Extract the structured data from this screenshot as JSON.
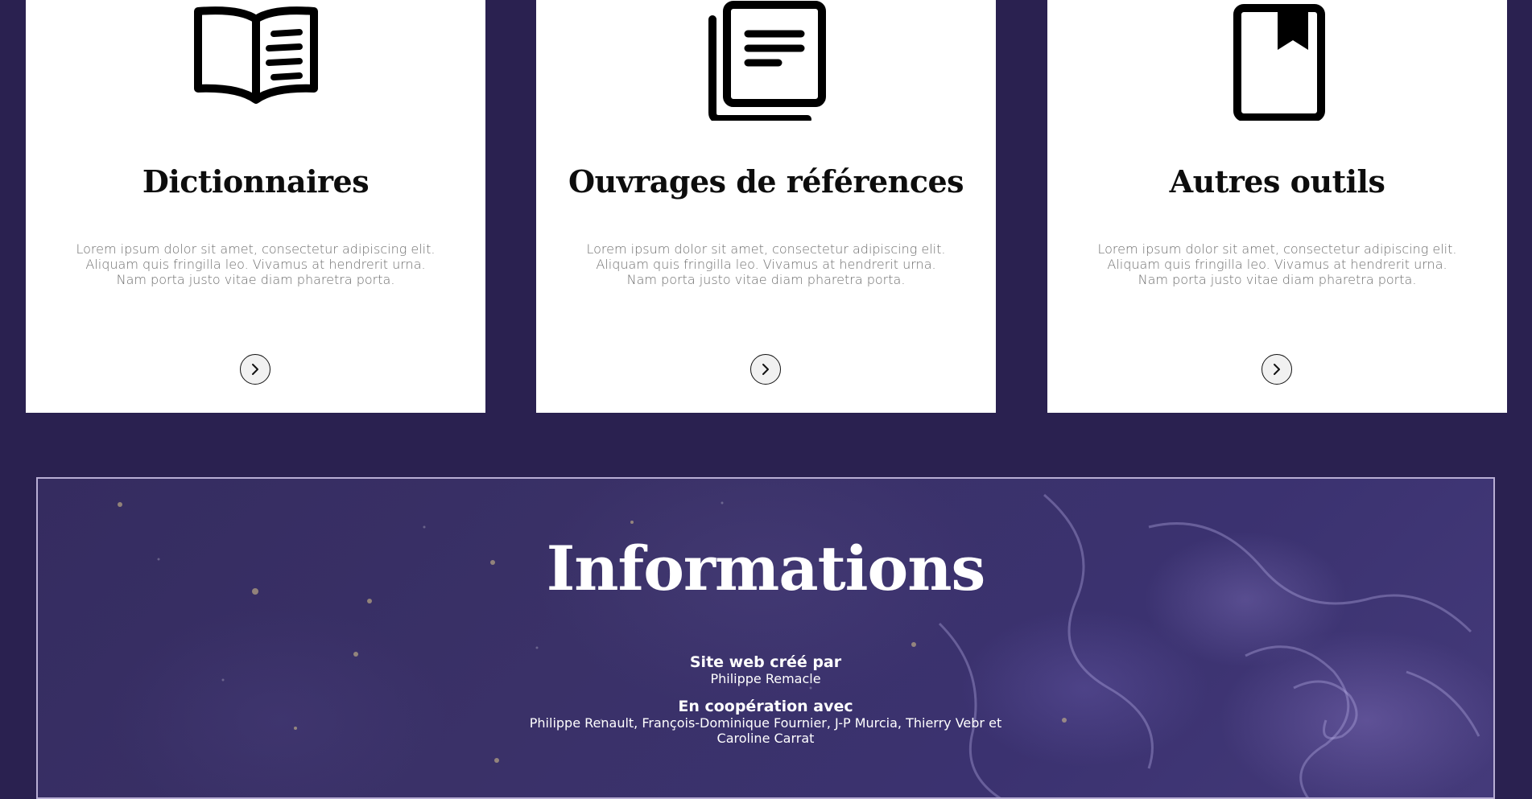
{
  "cards": [
    {
      "icon": "open-book-icon",
      "title": "Dictionnaires",
      "text": "Lorem ipsum dolor sit amet, consectetur adipiscing elit. Aliquam quis fringilla leo. Vivamus at hendrerit urna. Nam porta justo vitae diam pharetra porta.",
      "arrow_icon": "chevron-right-icon"
    },
    {
      "icon": "documents-stack-icon",
      "title": "Ouvrages de références",
      "text": "Lorem ipsum dolor sit amet, consectetur adipiscing elit. Aliquam quis fringilla leo. Vivamus at hendrerit urna. Nam porta justo vitae diam pharetra porta.",
      "arrow_icon": "chevron-right-icon"
    },
    {
      "icon": "bookmark-book-icon",
      "title": "Autres outils",
      "text": "Lorem ipsum dolor sit amet, consectetur adipiscing elit. Aliquam quis fringilla leo. Vivamus at hendrerit urna. Nam porta justo vitae diam pharetra porta.",
      "arrow_icon": "chevron-right-icon"
    }
  ],
  "info": {
    "title": "Informations",
    "created_by_label": "Site web créé par",
    "created_by_value": "Philippe Remacle",
    "cooperation_label": "En coopération avec",
    "cooperation_value": "Philippe Renault, François-Dominique Fournier, J-P Murcia, Thierry Vebr et Caroline Carrat"
  },
  "colors": {
    "page_background": "#2a2150",
    "card_background": "#ffffff",
    "info_border": "#b8aed4",
    "info_background": "#3a3168"
  }
}
